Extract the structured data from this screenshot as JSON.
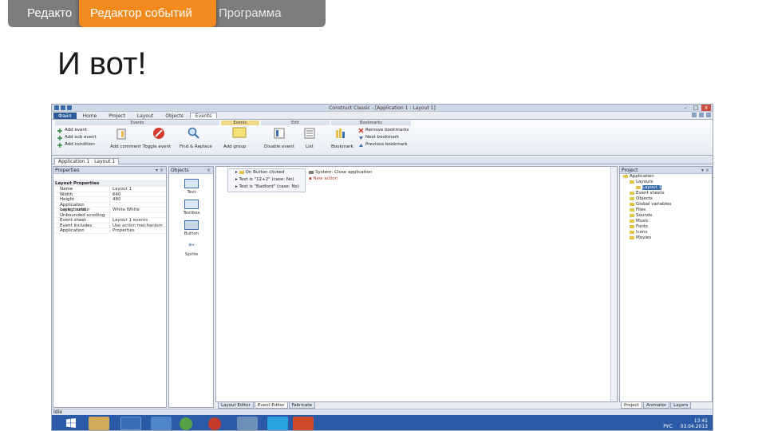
{
  "slide": {
    "tabs": [
      "Редакто",
      "Редактор событий",
      "Программа"
    ],
    "title": "И вот!"
  },
  "window": {
    "title": "Construct Classic - [Application 1 : Layout 1]",
    "ribbon_tabs": [
      "Файл",
      "Home",
      "Project",
      "Layout",
      "Objects",
      "Events"
    ],
    "groups": [
      "Events",
      "Events",
      "Edit",
      "Bookmarks"
    ],
    "ribbon_items": {
      "add_event": "Add event",
      "add_sub_event": "Add sub event",
      "add_condition": "Add condition",
      "add_comment": "Add comment",
      "toggle_event": "Toggle event",
      "find_replace": "Find & Replace",
      "add_group": "Add group",
      "disable": "Disable event",
      "list": "List",
      "bookmark": "Bookmark",
      "remove_bookmarks": "Remove bookmarks",
      "next_bookmark": "Next bookmark",
      "previous_bookmark": "Previous bookmark"
    },
    "doc_tab": "Application 1 : Layout 1",
    "properties": {
      "title": "Properties",
      "group": "Layout Properties",
      "rows": [
        {
          "k": "Name",
          "v": "Layout 1"
        },
        {
          "k": "Width",
          "v": "640"
        },
        {
          "k": "Height",
          "v": "480"
        },
        {
          "k": "Application background",
          "v": ""
        },
        {
          "k": "Layout colour",
          "v": "White White"
        },
        {
          "k": "Unbounded scrolling",
          "v": ""
        },
        {
          "k": "Event sheet",
          "v": "Layout 1 events"
        },
        {
          "k": "Event includes",
          "v": "Use action mechanism"
        },
        {
          "k": "Application",
          "v": "Properties"
        }
      ]
    },
    "objects": {
      "title": "Objects",
      "items": [
        "Text",
        "Textbox",
        "Button",
        "Sprite"
      ]
    },
    "events": {
      "conditions": [
        "On Button clicked",
        "Text is \"12+2\" (case: No)",
        "Text is \"Badford\" (case: No)"
      ],
      "actions": [
        "System: Close application",
        "New action"
      ]
    },
    "project": {
      "title": "Project",
      "items": [
        "Application",
        "Layouts",
        "Layout 1",
        "Event sheets",
        "Objects",
        "Global variables",
        "Files",
        "Sounds",
        "Music",
        "Fonts",
        "Icons",
        "Movies"
      ]
    },
    "bottom_tabs": [
      "Layout Editor",
      "Event Editor",
      "Fabricate"
    ],
    "project_tabs": [
      "Project",
      "Animator",
      "Layers"
    ],
    "status": "Idle",
    "tray_time": "13:41",
    "tray_date": "03.04.2013",
    "tray_lang": "РУС"
  },
  "colors": {
    "tab_bg": "#7d7d7d",
    "tab_active": "#f28a1e",
    "taskbar": "#2b5ba7"
  }
}
